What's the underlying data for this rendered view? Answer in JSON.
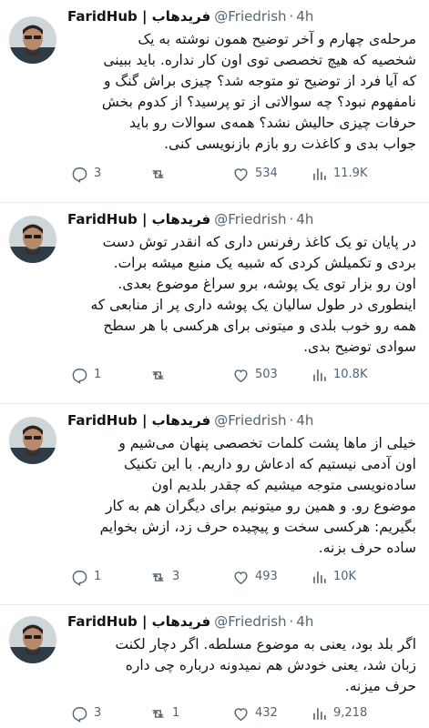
{
  "author": {
    "name": "FaridHub | فریدهاب",
    "handle": "@Friedrish",
    "separator": "·"
  },
  "colors": {
    "text": "#0f1419",
    "muted": "#536471",
    "divider": "#e6ecf0"
  },
  "icons": {
    "reply": "reply-icon",
    "retweet": "retweet-icon",
    "like": "heart-icon",
    "views": "views-icon",
    "avatar": "avatar-portrait"
  },
  "tweets": [
    {
      "time": "4h",
      "lines": [
        "مرحله‌ی چهارم و آخر توضیح همون نوشته به یک",
        "شخصیه که هیچ تخصصی توی اون کار نداره. باید ببینی",
        "که آیا فرد از توضیح تو متوجه شد؟ چیزی براش گنگ و",
        "نامفهوم نبود؟ چه سوالاتی از تو پرسید؟ از کدوم بخش",
        "حرفات چیزی حالیش نشد؟ همه‌ی سوالات رو باید",
        "جواب بدی و کاغذت رو بازم بازنویسی کنی."
      ],
      "replies": "3",
      "retweets": "",
      "likes": "534",
      "views": "11.9K"
    },
    {
      "time": "4h",
      "lines": [
        "در پایان تو یک کاغذ رفرنس داری که انقدر توش دست",
        "بردی و تکمیلش کردی که شبیه یک منبع میشه برات.",
        "اون رو بزار توی یک پوشه، برو سراغ موضوع بعدی.",
        "اینطوری در طول سالیان یک پوشه داری پر از منابعی که",
        "همه رو خوب بلدی و میتونی برای هرکسی با هر سطح",
        "سوادی توضیح بدی."
      ],
      "replies": "1",
      "retweets": "",
      "likes": "503",
      "views": "10.8K"
    },
    {
      "time": "4h",
      "lines": [
        "خیلی از ماها پشت کلمات تخصصی پنهان می‌شیم و",
        "اون آدمی نیستیم که ادعاش رو داریم. با این تکنیک",
        "ساده‌نویسی متوجه میشیم که چقدر بلدیم اون",
        "موضوع رو. و همین رو میتونیم برای دیگران هم به کار",
        "بگیریم: هرکسی سخت و پیچیده حرف زد، ازش بخوایم",
        "ساده حرف بزنه."
      ],
      "replies": "1",
      "retweets": "3",
      "likes": "493",
      "views": "10K"
    },
    {
      "time": "4h",
      "lines": [
        "اگر بلد بود، یعنی به موضوع مسلطه. اگر دچار لکنت",
        "زبان شد، یعنی خودش هم نمیدونه درباره چی داره",
        "حرف میزنه."
      ],
      "replies": "3",
      "retweets": "1",
      "likes": "432",
      "views": "9,218"
    }
  ]
}
